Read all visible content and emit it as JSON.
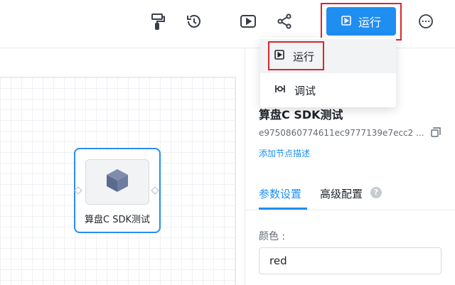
{
  "toolbar": {
    "icons": [
      "paint-roller-icon",
      "history-icon",
      "play-preview-icon",
      "share-icon",
      "more-icon"
    ],
    "run_label": "运行"
  },
  "run_menu": {
    "items": [
      {
        "label": "运行",
        "icon": "play-square-icon"
      },
      {
        "label": "调试",
        "icon": "debug-icon"
      }
    ]
  },
  "canvas": {
    "node": {
      "label": "算盘C SDK测试",
      "icon": "cube-icon"
    }
  },
  "panel": {
    "title": "算盘C SDK测试",
    "id": "e9750860774611ec9777139e7ecc2 ...",
    "add_description": "添加节点描述",
    "tabs": [
      {
        "label": "参数设置",
        "active": true
      },
      {
        "label": "高级配置",
        "active": false
      }
    ],
    "help": "?",
    "fields": {
      "color": {
        "label": "颜色 :",
        "value": "red"
      }
    }
  },
  "colors": {
    "accent": "#1f8ef1",
    "highlight_box": "#d8262c",
    "node_border": "#2a8cf0"
  }
}
